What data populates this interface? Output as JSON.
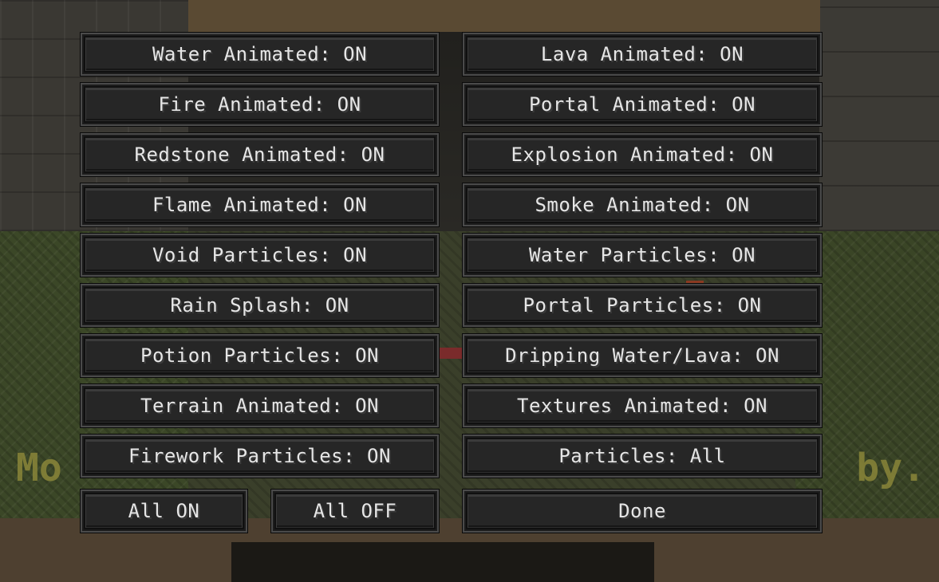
{
  "background": {
    "overlay_left": "Mo",
    "overlay_right": "by."
  },
  "options": {
    "left": [
      "Water Animated: ON",
      "Fire Animated: ON",
      "Redstone Animated: ON",
      "Flame Animated: ON",
      "Void Particles: ON",
      "Rain Splash: ON",
      "Potion Particles: ON",
      "Terrain Animated: ON",
      "Firework Particles: ON"
    ],
    "right": [
      "Lava Animated: ON",
      "Portal Animated: ON",
      "Explosion Animated: ON",
      "Smoke Animated: ON",
      "Water Particles: ON",
      "Portal Particles: ON",
      "Dripping Water/Lava: ON",
      "Textures Animated: ON",
      "Particles: All"
    ]
  },
  "footer": {
    "all_on": "All ON",
    "all_off": "All OFF",
    "done": "Done"
  }
}
